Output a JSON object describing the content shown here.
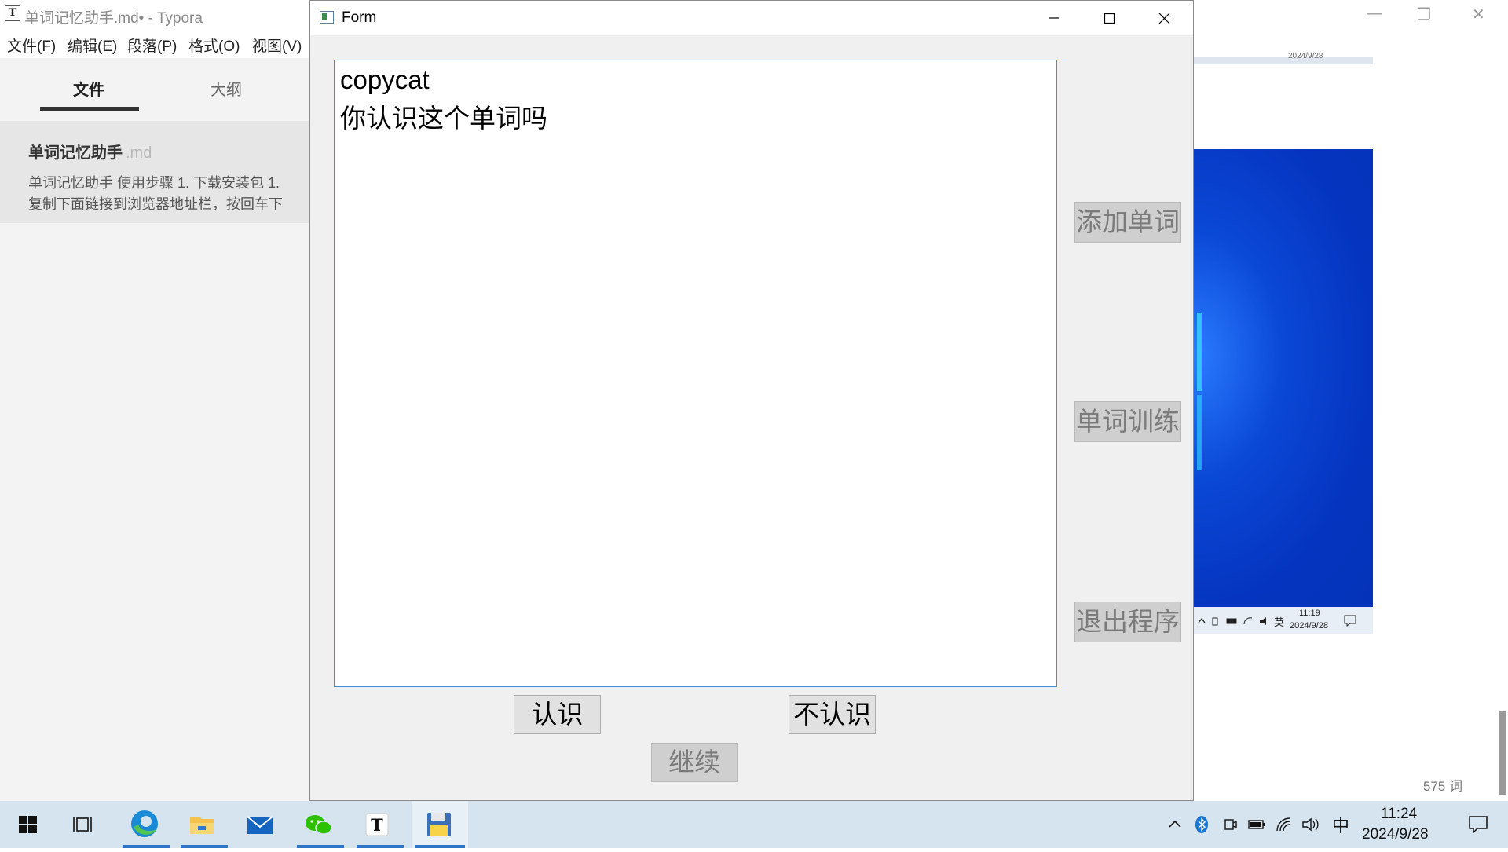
{
  "typora": {
    "app_icon_letter": "T",
    "title": "单词记忆助手.md• - Typora",
    "menu": [
      "文件(F)",
      "编辑(E)",
      "段落(P)",
      "格式(O)",
      "视图(V)"
    ],
    "sidebar_tabs": {
      "files": "文件",
      "outline": "大纲"
    },
    "file_entry": {
      "name": "单词记忆助手",
      "ext": ".md",
      "preview_line1": "单词记忆助手 使用步骤 1. 下载安装包 1.",
      "preview_line2": "复制下面链接到浏览器地址栏，按回车下"
    },
    "word_count": "575 词"
  },
  "thumbnail": {
    "top_date": "2024/9/28",
    "tray_ime": "英",
    "tray_time": "11:19",
    "tray_date": "2024/9/28"
  },
  "form": {
    "title": "Form",
    "text_lines": [
      "copycat",
      "你认识这个单词吗"
    ],
    "side_buttons": {
      "add": "添加单词",
      "train": "单词训练",
      "exit": "退出程序"
    },
    "bottom_buttons": {
      "know": "认识",
      "dont_know": "不认识",
      "continue": "继续"
    }
  },
  "taskbar": {
    "apps": [
      "start",
      "task-view",
      "edge",
      "file-explorer",
      "mail",
      "wechat",
      "typora",
      "python-app"
    ],
    "ime": "中",
    "time": "11:24",
    "date": "2024/9/28"
  },
  "colors": {
    "accent_blue": "#3d8fd8",
    "taskbar_bg": "#d6e4ef",
    "taskbar_indicator": "#2e74c7",
    "disabled_button_bg": "#cfcfcf",
    "disabled_button_text": "#7b7b7b"
  }
}
